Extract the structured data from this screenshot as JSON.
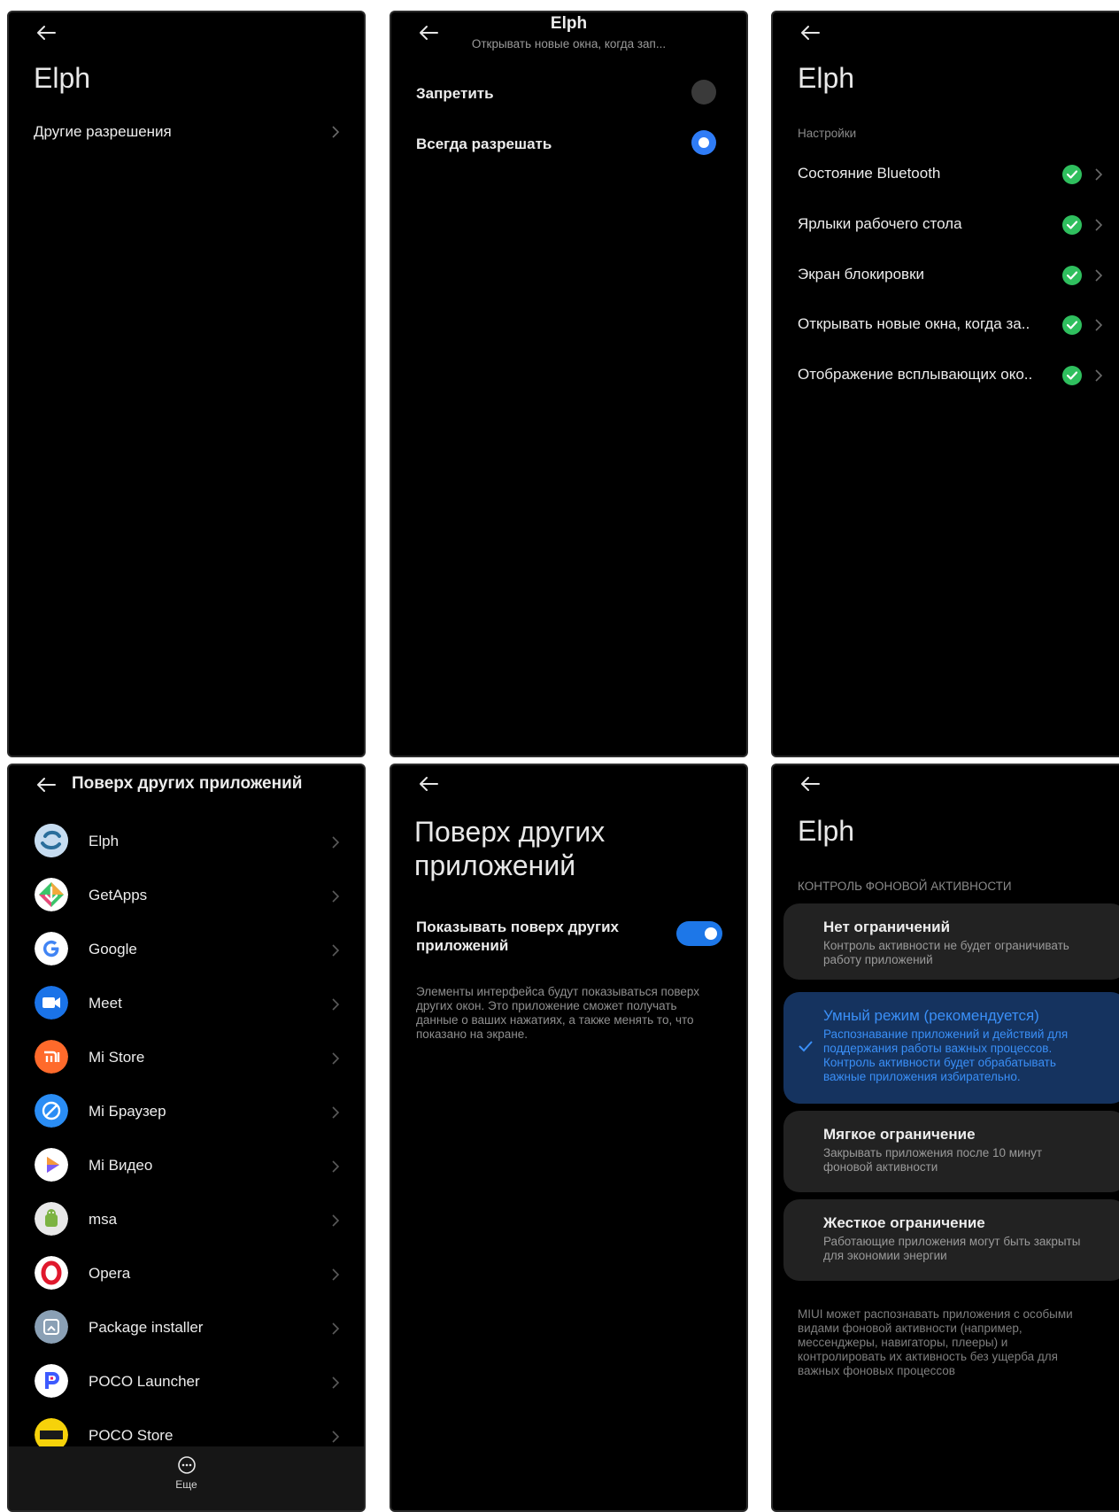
{
  "panel1": {
    "title": "Elph",
    "item": "Другие разрешения"
  },
  "panel2": {
    "title": "Elph",
    "subtitle": "Открывать новые окна, когда зап...",
    "options": [
      {
        "label": "Запретить",
        "selected": false
      },
      {
        "label": "Всегда разрешать",
        "selected": true
      }
    ]
  },
  "panel3": {
    "title": "Elph",
    "section": "Настройки",
    "items": [
      "Состояние Bluetooth",
      "Ярлыки рабочего стола",
      "Экран блокировки",
      "Открывать новые окна, когда за..",
      "Отображение всплывающих око.."
    ],
    "status_color": "#2fbf5e"
  },
  "panel4": {
    "title": "Поверх других приложений",
    "apps": [
      "Elph",
      "GetApps",
      "Google",
      "Meet",
      "Mi Store",
      "Mi Браузер",
      "Mi Видео",
      "msa",
      "Opera",
      "Package installer",
      "POCO Launcher",
      "POCO Store"
    ],
    "bottom_label": "Еще"
  },
  "panel5": {
    "title_line1": "Поверх других",
    "title_line2": "приложений",
    "toggle_label_line1": "Показывать поверх других",
    "toggle_label_line2": "приложений",
    "toggle_on": true,
    "description": "Элементы интерфейса будут показываться поверх других окон. Это приложение сможет получать данные о ваших нажатиях, а также менять то, что показано на экране.",
    "accent": "#1d77e8"
  },
  "panel6": {
    "title": "Elph",
    "section": "КОНТРОЛЬ ФОНОВОЙ АКТИВНОСТИ",
    "options": [
      {
        "title": "Нет ограничений",
        "desc": "Контроль активности не будет ограничивать работу приложений"
      },
      {
        "title": "Умный режим (рекомендуется)",
        "desc": "Распознавание приложений и действий для поддержания работы важных процессов. Контроль активности будет обрабатывать важные приложения избирательно."
      },
      {
        "title": "Мягкое ограничение",
        "desc": "Закрывать приложения после 10 минут фоновой активности"
      },
      {
        "title": "Жесткое ограничение",
        "desc": "Работающие приложения могут быть закрыты для экономии энергии"
      }
    ],
    "footer": "MIUI может распознавать приложения с особыми видами фоновой активности (например, мессенджеры, навигаторы, плееры) и контролировать их активность без ущерба для важных фоновых процессов",
    "selected_color": "#15335f"
  }
}
